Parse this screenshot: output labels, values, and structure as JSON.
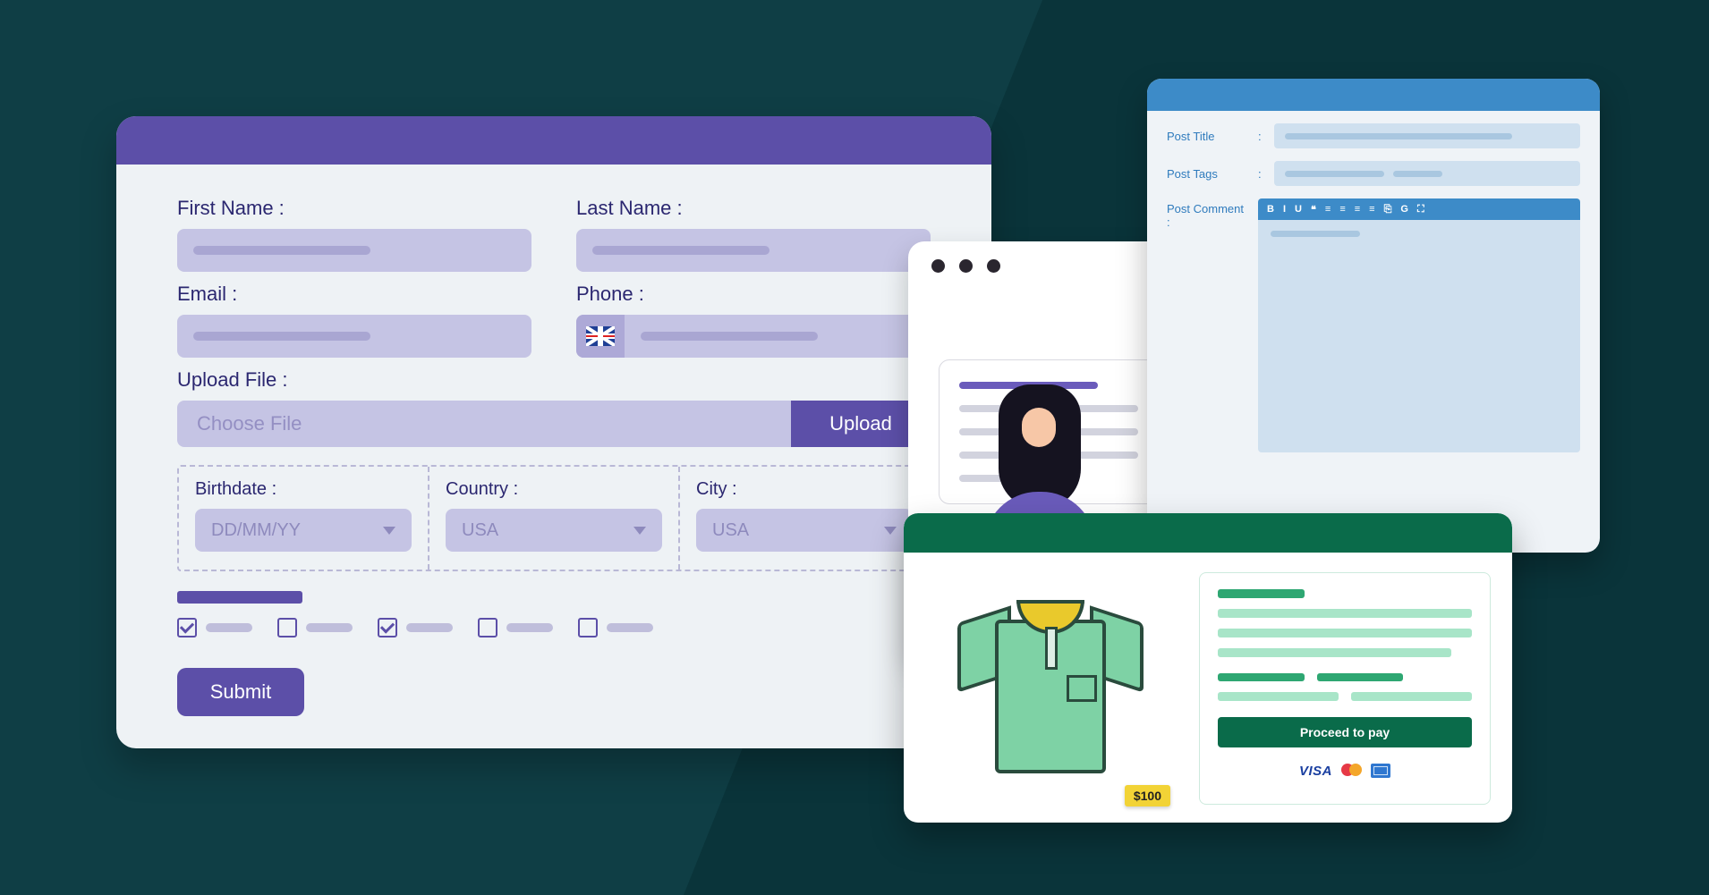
{
  "form": {
    "labels": {
      "first_name": "First Name :",
      "last_name": "Last Name :",
      "email": "Email :",
      "phone": "Phone :",
      "upload": "Upload File :",
      "birthdate": "Birthdate :",
      "country": "Country :",
      "city": "City :"
    },
    "choose_file_placeholder": "Choose File",
    "upload_button": "Upload",
    "birthdate_placeholder": "DD/MM/YY",
    "country_value": "USA",
    "city_value": "USA",
    "checkboxes": [
      true,
      false,
      true,
      false,
      false
    ],
    "submit": "Submit"
  },
  "post": {
    "title_label": "Post Title",
    "tags_label": "Post Tags",
    "comment_label": "Post Comment :",
    "toolbar_icons": [
      "B",
      "I",
      "U",
      "❝",
      "≡",
      "≡",
      "≡",
      "≡",
      "⎘",
      "G",
      "⛶"
    ]
  },
  "shop": {
    "price": "$100",
    "proceed": "Proceed to pay",
    "visa": "VISA"
  }
}
